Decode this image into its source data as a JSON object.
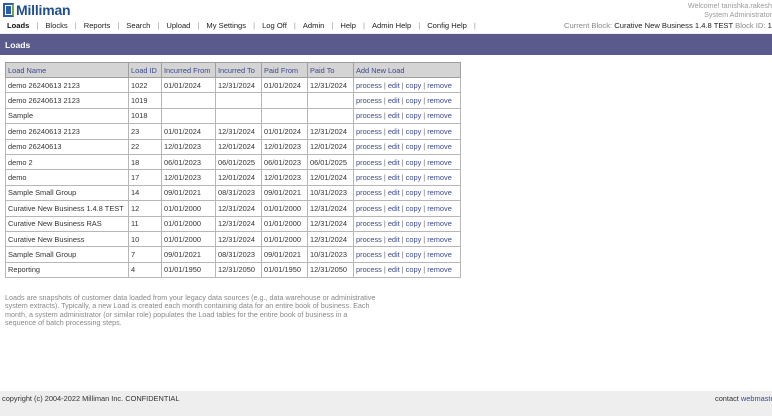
{
  "brand": {
    "name": "Milliman"
  },
  "user": {
    "welcome": "Welcome! tanishka.rakesh",
    "role": "System Administrator"
  },
  "nav": [
    {
      "label": "Loads"
    },
    {
      "label": "Blocks"
    },
    {
      "label": "Reports"
    },
    {
      "label": "Search"
    },
    {
      "label": "Upload"
    },
    {
      "label": "My Settings"
    },
    {
      "label": "Log Off"
    },
    {
      "label": "Admin"
    },
    {
      "label": "Help"
    },
    {
      "label": "Admin Help"
    },
    {
      "label": "Config Help"
    }
  ],
  "block": {
    "label": "Current Block:",
    "name": "Curative New Business 1.4.8 TEST",
    "id_label": "Block ID:",
    "id_value": "1"
  },
  "page": {
    "title": "Loads"
  },
  "table": {
    "headers": [
      "Load Name",
      "Load ID",
      "Incurred From",
      "Incurred To",
      "Paid From",
      "Paid To",
      "Add New Load"
    ],
    "actions": [
      "process",
      "edit",
      "copy",
      "remove"
    ],
    "rows": [
      [
        "demo 26240613 2123",
        "1022",
        "01/01/2024",
        "12/31/2024",
        "01/01/2024",
        "12/31/2024"
      ],
      [
        "demo 26240613 2123",
        "1019",
        "",
        "",
        "",
        ""
      ],
      [
        "Sample",
        "1018",
        "",
        "",
        "",
        ""
      ],
      [
        "demo 26240613 2123",
        "23",
        "01/01/2024",
        "12/31/2024",
        "01/01/2024",
        "12/31/2024"
      ],
      [
        "demo 26240613",
        "22",
        "12/01/2023",
        "12/01/2024",
        "12/01/2023",
        "12/01/2024"
      ],
      [
        "demo 2",
        "18",
        "06/01/2023",
        "06/01/2025",
        "06/01/2023",
        "06/01/2025"
      ],
      [
        "demo",
        "17",
        "12/01/2023",
        "12/01/2024",
        "12/01/2023",
        "12/01/2024"
      ],
      [
        "Sample Small Group",
        "14",
        "09/01/2021",
        "08/31/2023",
        "09/01/2021",
        "10/31/2023"
      ],
      [
        "Curative New Business 1.4.8 TEST",
        "12",
        "01/01/2000",
        "12/31/2024",
        "01/01/2000",
        "12/31/2024"
      ],
      [
        "Curative New Business RAS",
        "11",
        "01/01/2000",
        "12/31/2024",
        "01/01/2000",
        "12/31/2024"
      ],
      [
        "Curative New Business",
        "10",
        "01/01/2000",
        "12/31/2024",
        "01/01/2000",
        "12/31/2024"
      ],
      [
        "Sample Small Group",
        "7",
        "09/01/2021",
        "08/31/2023",
        "09/01/2021",
        "10/31/2023"
      ],
      [
        "Reporting",
        "4",
        "01/01/1950",
        "12/31/2050",
        "01/01/1950",
        "12/31/2050"
      ]
    ]
  },
  "description": "Loads are snapshots of customer data loaded from your legacy data sources (e.g., data warehouse or administrative system extracts). Typically, a new Load is created each month containing data for an entire book of business. Each month, a system administrator (or similar role) populates the Load tables for the entire book of business in a sequence of batch processing steps.",
  "footer": {
    "copyright": "copyright (c) 2004-2022 Milliman Inc. CONFIDENTIAL",
    "contact_label": "contact",
    "contact_link": "webmaster"
  }
}
